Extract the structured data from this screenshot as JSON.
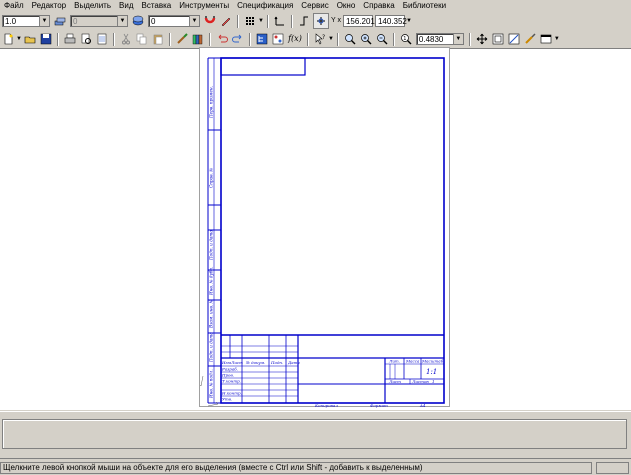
{
  "menu": [
    {
      "label": "Файл"
    },
    {
      "label": "Редактор"
    },
    {
      "label": "Выделить"
    },
    {
      "label": "Вид"
    },
    {
      "label": "Вставка"
    },
    {
      "label": "Инструменты"
    },
    {
      "label": "Спецификация"
    },
    {
      "label": "Сервис"
    },
    {
      "label": "Окно"
    },
    {
      "label": "Справка"
    },
    {
      "label": "Библиотеки"
    }
  ],
  "toolbar1": {
    "scale_value": "1.0",
    "layer_value": "0",
    "style_value": "0",
    "coord_x": "156.201",
    "coord_y": "140.352",
    "coord_label": "Y x"
  },
  "toolbar2": {
    "zoom_value": "0.4830"
  },
  "drawing": {
    "side_labels": [
      "Перв. примен.",
      "Справ. №",
      "Подп. и дата",
      "Инв. № дубл.",
      "Взам. инв. №",
      "Подп. и дата",
      "Инв. № подл."
    ],
    "stamp": {
      "col_headers": [
        "Изм",
        "Лист",
        "№ докум.",
        "Подп.",
        "Дата"
      ],
      "row_labels": [
        "Разраб.",
        "Пров.",
        "Т.контр.",
        "",
        "Н.контр.",
        "Утв."
      ],
      "lit_label": "Лит.",
      "mass_label": "Масса",
      "scale_label": "Масштаб",
      "scale_value": "1:1",
      "sheet_label": "Лист",
      "sheets_label": "Листов",
      "sheets_value": "1"
    },
    "copied_label": "Копировал",
    "format_label": "Формат",
    "format_value": "A4"
  },
  "status": {
    "hint": "Щелкните левой кнопкой мыши на объекте для его выделения (вместе с Ctrl или Shift - добавить к выделенным)"
  }
}
